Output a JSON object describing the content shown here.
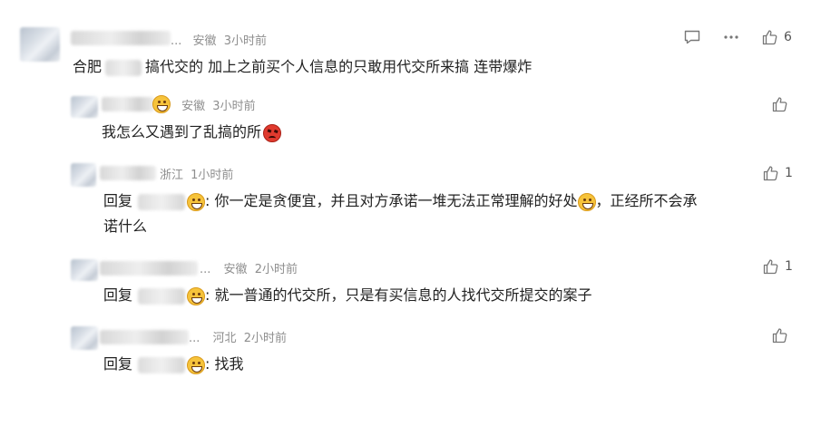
{
  "comments": [
    {
      "location": "安徽",
      "time": "3小时前",
      "name_suffix": "...",
      "text": "搞代交的 加上之前买个人信息的只敢用代交所来搞 连带爆炸",
      "prefix": "合肥",
      "likes": "6"
    },
    {
      "location": "安徽",
      "time": "3小时前",
      "text": "我怎么又遇到了乱搞的所",
      "likes": ""
    },
    {
      "location": "浙江",
      "time": "1小时前",
      "reply_label": "回复",
      "text_line1": ": 你一定是贪便宜，并且对方承诺一堆无法正常理解的好处",
      "text_line1_tail": "，正经所不会承",
      "text_line2": "诺什么",
      "likes": "1"
    },
    {
      "location": "安徽",
      "time": "2小时前",
      "name_suffix": "...",
      "reply_label": "回复",
      "text": ": 就一普通的代交所，只是有买信息的人找代交所提交的案子",
      "likes": "1"
    },
    {
      "location": "河北",
      "time": "2小时前",
      "name_suffix": "...",
      "reply_label": "回复",
      "text": ": 找我",
      "likes": ""
    }
  ]
}
